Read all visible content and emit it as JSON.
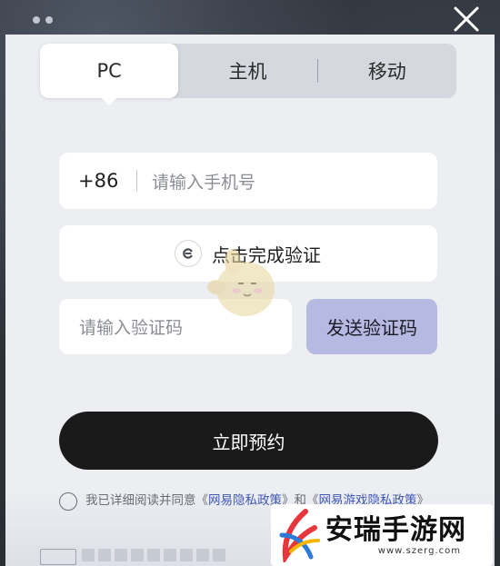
{
  "tabs": [
    {
      "label": "PC",
      "active": true
    },
    {
      "label": "主机",
      "active": false
    },
    {
      "label": "移动",
      "active": false
    }
  ],
  "phone": {
    "country_code": "+86",
    "placeholder": "请输入手机号",
    "value": ""
  },
  "captcha": {
    "label": "点击完成验证",
    "icon": "shield-icon"
  },
  "code": {
    "placeholder": "请输入验证码",
    "value": ""
  },
  "send_code": {
    "label": "发送验证码"
  },
  "submit": {
    "label": "立即预约"
  },
  "agreement": {
    "prefix": "我已详细阅读并同意《",
    "link1": "网易隐私政策",
    "mid": "》和《",
    "link2": "网易游戏隐私政策",
    "suffix": "》",
    "checked": false
  },
  "watermark": {
    "title": "安瑞手游网",
    "url": "www.szerg.com"
  },
  "colors": {
    "panel": "#eceef2",
    "tab_bar": "#d5d8df",
    "send_button": "#b6b9e2",
    "submit_button": "#1a1a1a",
    "link": "#3f57b6"
  }
}
